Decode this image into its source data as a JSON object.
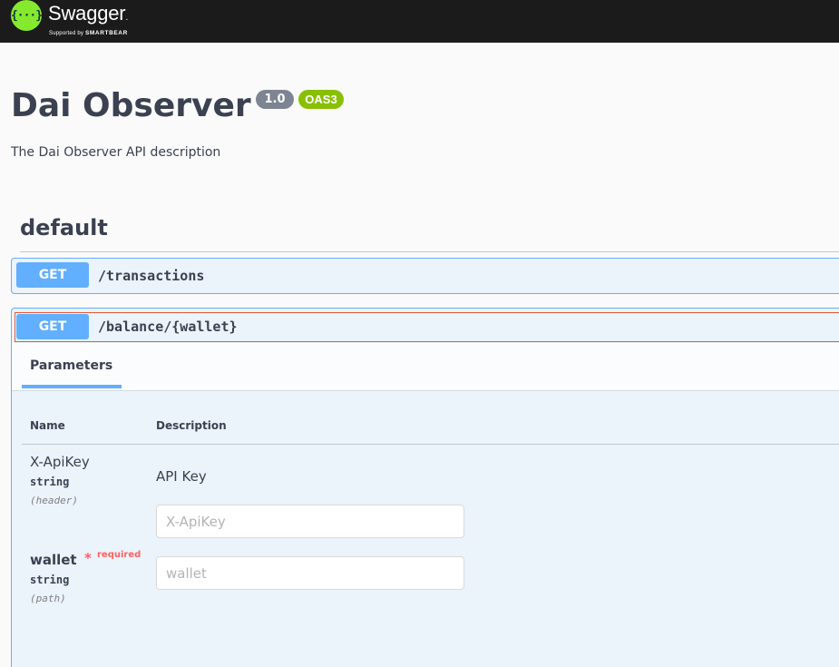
{
  "topbar": {
    "logo_glyph": "{···}",
    "brand": "Swagger",
    "brand_mark": ".",
    "supported_by": "Supported by",
    "smartbear": "SMARTBEAR"
  },
  "info": {
    "title": "Dai Observer",
    "version": "1.0",
    "oas": "OAS3",
    "description": "The Dai Observer API description"
  },
  "tag": {
    "name": "default"
  },
  "operations": [
    {
      "method": "GET",
      "path": "/transactions"
    },
    {
      "method": "GET",
      "path": "/balance/{wallet}"
    }
  ],
  "parameters_panel": {
    "tab_label": "Parameters",
    "col_name": "Name",
    "col_description": "Description",
    "params": [
      {
        "name": "X-ApiKey",
        "type": "string",
        "in": "(header)",
        "description": "API Key",
        "placeholder": "X-ApiKey"
      },
      {
        "name": "wallet",
        "required_star": "*",
        "required_label": "required",
        "type": "string",
        "in": "(path)",
        "placeholder": "wallet"
      }
    ]
  },
  "colors": {
    "get": "#61affe",
    "accent_green": "#89bf04",
    "topbar": "#1b1b1b",
    "required": "#ff6060"
  }
}
